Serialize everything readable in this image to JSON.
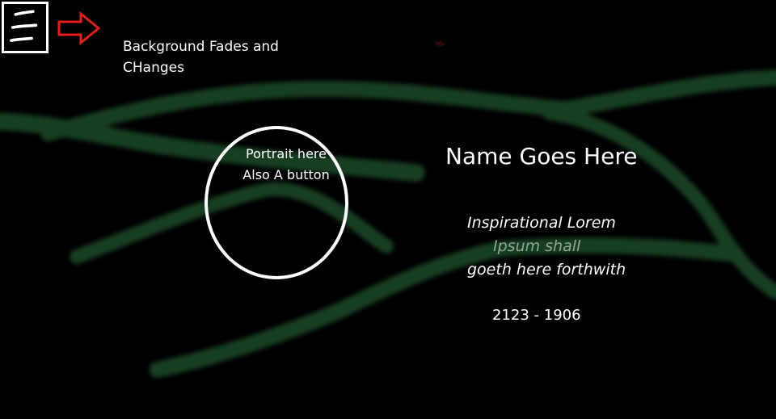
{
  "menu": {
    "icon": "hamburger-menu-icon"
  },
  "annotation": {
    "arrow_icon": "right-arrow-icon",
    "arrow_color": "#e0201c",
    "line1": "Background Fades and",
    "line2": "CHanges"
  },
  "portrait": {
    "line1": "Portrait here",
    "line2": "Also A button"
  },
  "profile": {
    "name": "Name Goes Here",
    "quote_line1": "Inspirational Lorem",
    "quote_line2": "Ipsum shall",
    "quote_line3": "goeth here forthwith",
    "dates": "2123 - 1906"
  },
  "colors": {
    "background": "#000000",
    "stroke": "#1f4a2c",
    "text": "#ffffff"
  }
}
